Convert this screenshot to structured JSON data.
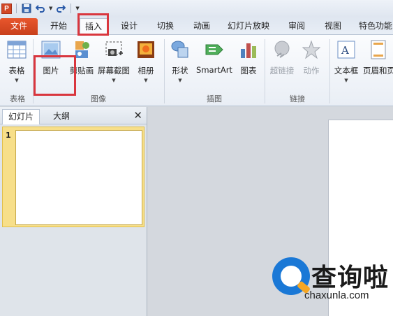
{
  "quick_access": {
    "app_icon_letter": "P"
  },
  "tabs": [
    {
      "label": "文件"
    },
    {
      "label": "开始"
    },
    {
      "label": "插入"
    },
    {
      "label": "设计"
    },
    {
      "label": "切换"
    },
    {
      "label": "动画"
    },
    {
      "label": "幻灯片放映"
    },
    {
      "label": "审阅"
    },
    {
      "label": "视图"
    },
    {
      "label": "特色功能"
    }
  ],
  "ribbon": {
    "table": {
      "label": "表格",
      "group": "表格"
    },
    "picture": {
      "label": "图片"
    },
    "clipart": {
      "label": "剪贴画"
    },
    "screenshot": {
      "label": "屏幕截图"
    },
    "album": {
      "label": "相册"
    },
    "images_group": "图像",
    "shapes": {
      "label": "形状"
    },
    "smartart": {
      "label": "SmartArt"
    },
    "chart": {
      "label": "图表"
    },
    "illustrations_group": "插图",
    "hyperlink": {
      "label": "超链接"
    },
    "action": {
      "label": "动作"
    },
    "links_group": "链接",
    "textbox": {
      "label": "文本框"
    },
    "header_footer": {
      "label": "页眉和页"
    }
  },
  "panel": {
    "tab_slides": "幻灯片",
    "tab_outline": "大纲",
    "slide_number": "1"
  },
  "watermark": {
    "title": "查询啦",
    "url": "chaxunla.com"
  },
  "colors": {
    "file_tab": "#d24726",
    "highlight": "#d9363e",
    "selection": "#f7df8a",
    "watermark_blue": "#1a78d6",
    "watermark_orange": "#f5a623"
  }
}
